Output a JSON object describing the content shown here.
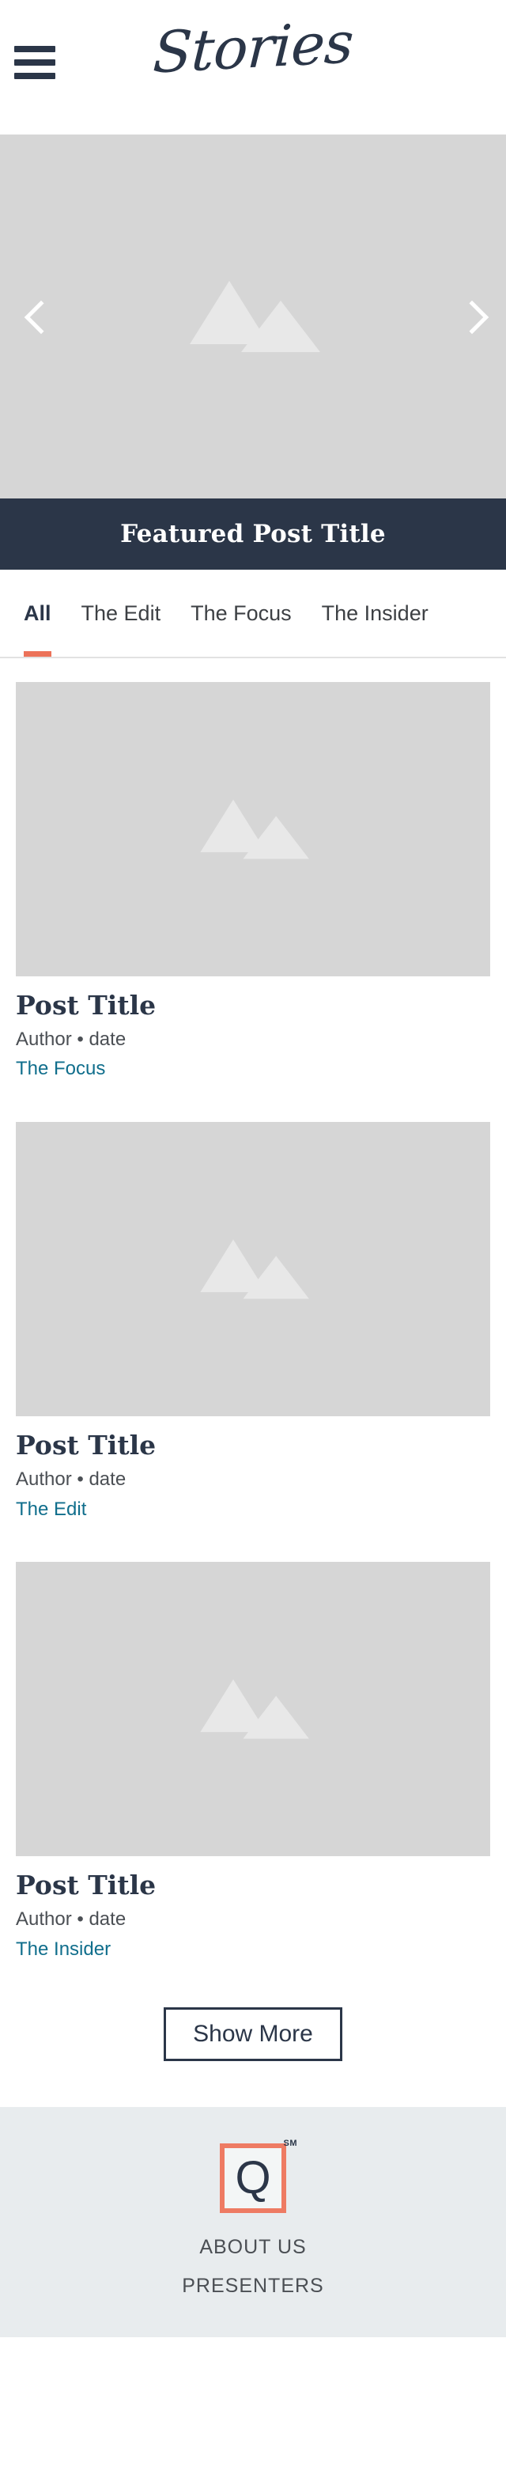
{
  "header": {
    "brand": "Stories",
    "menu_icon": "hamburger-menu-icon"
  },
  "hero": {
    "prev_label": "‹",
    "next_label": "›",
    "image_placeholder": "mountain-placeholder-icon",
    "featured_title": "Featured Post Title"
  },
  "tabs": [
    {
      "label": "All",
      "active": true
    },
    {
      "label": "The Edit",
      "active": false
    },
    {
      "label": "The Focus",
      "active": false
    },
    {
      "label": "The Insider",
      "active": false
    }
  ],
  "posts": [
    {
      "title": "Post Title",
      "meta": "Author • date",
      "category": "The Focus"
    },
    {
      "title": "Post Title",
      "meta": "Author • date",
      "category": "The Edit"
    },
    {
      "title": "Post Title",
      "meta": "Author • date",
      "category": "The Insider"
    }
  ],
  "show_more": {
    "label": "Show More"
  },
  "footer": {
    "logo_letter": "Q",
    "logo_mark": "SM",
    "links": [
      {
        "label": "ABOUT US"
      },
      {
        "label": "PRESENTERS"
      }
    ]
  },
  "colors": {
    "navy": "#2b3648",
    "coral": "#ec7259",
    "teal_link": "#106e8c",
    "placeholder_gray": "#d6d6d6",
    "footer_bg": "#e8ecee",
    "meta_gray": "#4b4f54"
  }
}
